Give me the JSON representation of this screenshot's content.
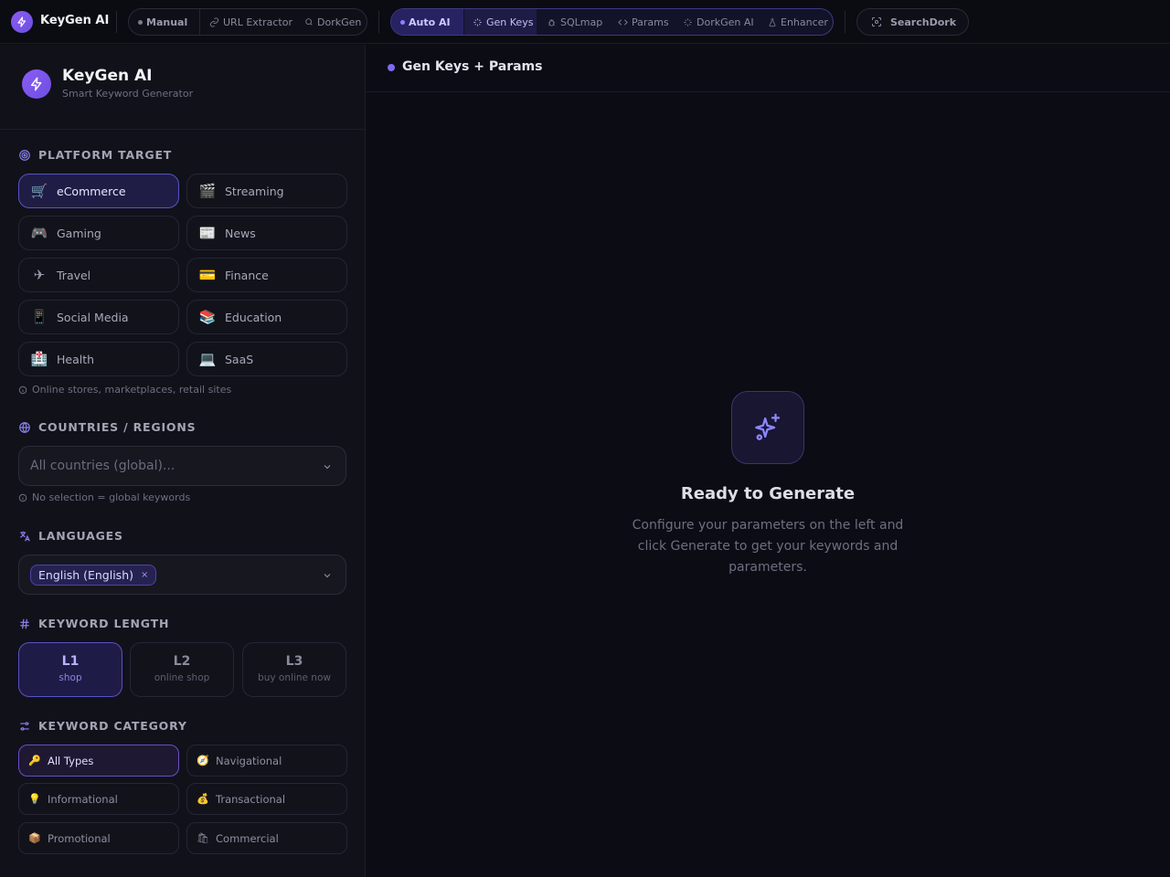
{
  "topbar": {
    "brand": "KeyGen AI",
    "manual_group": {
      "label": "Manual",
      "items": [
        "URL Extractor",
        "DorkGen"
      ]
    },
    "auto_group": {
      "label": "Auto AI",
      "items": [
        "Gen Keys",
        "SQLmap",
        "Params",
        "DorkGen AI",
        "Enhancer"
      ]
    },
    "searchdork": "SearchDork"
  },
  "sidebar": {
    "title": "KeyGen AI",
    "subtitle": "Smart Keyword Generator",
    "platform": {
      "heading": "PLATFORM TARGET",
      "items": [
        {
          "label": "eCommerce",
          "emoji": "🛒",
          "selected": true
        },
        {
          "label": "Streaming",
          "emoji": "🎬"
        },
        {
          "label": "Gaming",
          "emoji": "🎮"
        },
        {
          "label": "News",
          "emoji": "📰"
        },
        {
          "label": "Travel",
          "emoji": "✈"
        },
        {
          "label": "Finance",
          "emoji": "💳"
        },
        {
          "label": "Social Media",
          "emoji": "📱"
        },
        {
          "label": "Education",
          "emoji": "📚"
        },
        {
          "label": "Health",
          "emoji": "🏥"
        },
        {
          "label": "SaaS",
          "emoji": "💻"
        }
      ],
      "hint": "Online stores, marketplaces, retail sites"
    },
    "countries": {
      "heading": "COUNTRIES / REGIONS",
      "placeholder": "All countries (global)...",
      "hint": "No selection = global keywords"
    },
    "languages": {
      "heading": "LANGUAGES",
      "chip": "English (English)",
      "chip_remove": "×"
    },
    "keyword_length": {
      "heading": "KEYWORD LENGTH",
      "options": [
        {
          "level": "L1",
          "example": "shop",
          "selected": true
        },
        {
          "level": "L2",
          "example": "online shop"
        },
        {
          "level": "L3",
          "example": "buy online now"
        }
      ]
    },
    "keyword_category": {
      "heading": "KEYWORD CATEGORY",
      "items": [
        {
          "label": "All Types",
          "emoji": "🔑",
          "selected": true
        },
        {
          "label": "Navigational",
          "emoji": "🧭"
        },
        {
          "label": "Informational",
          "emoji": "💡"
        },
        {
          "label": "Transactional",
          "emoji": "💰"
        },
        {
          "label": "Promotional",
          "emoji": "📦"
        },
        {
          "label": "Commercial",
          "emoji": "🛍"
        }
      ]
    }
  },
  "main": {
    "title": "Gen Keys + Params",
    "empty_title": "Ready to Generate",
    "empty_desc": "Configure your parameters on the left and click Generate to get your keywords and parameters."
  }
}
